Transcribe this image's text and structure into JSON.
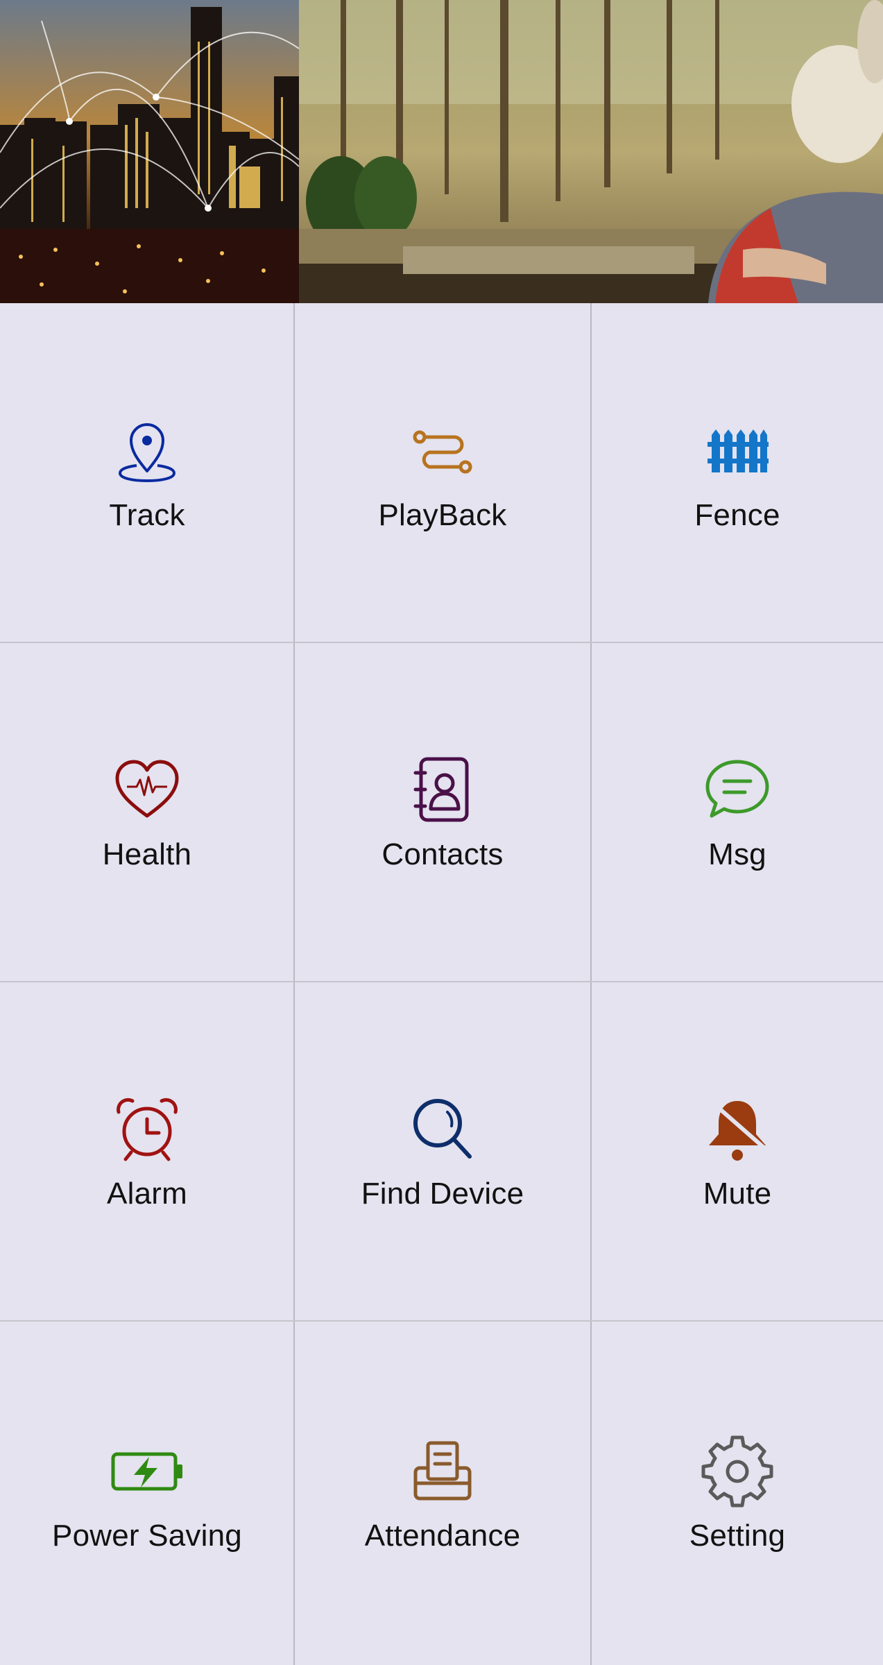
{
  "menu": {
    "items": [
      {
        "id": "track",
        "label": "Track",
        "icon": "map-pin-icon",
        "color": "#0a2aa0"
      },
      {
        "id": "playback",
        "label": "PlayBack",
        "icon": "route-icon",
        "color": "#b8731f"
      },
      {
        "id": "fence",
        "label": "Fence",
        "icon": "fence-icon",
        "color": "#1476c9"
      },
      {
        "id": "health",
        "label": "Health",
        "icon": "heart-pulse-icon",
        "color": "#8b0d0d"
      },
      {
        "id": "contacts",
        "label": "Contacts",
        "icon": "contact-book-icon",
        "color": "#4a1048"
      },
      {
        "id": "msg",
        "label": "Msg",
        "icon": "chat-bubble-icon",
        "color": "#3d9a2a"
      },
      {
        "id": "alarm",
        "label": "Alarm",
        "icon": "alarm-clock-icon",
        "color": "#a01212"
      },
      {
        "id": "find_device",
        "label": "Find Device",
        "icon": "magnifier-icon",
        "color": "#0e2e6b"
      },
      {
        "id": "mute",
        "label": "Mute",
        "icon": "bell-mute-icon",
        "color": "#9a3b10"
      },
      {
        "id": "power_saving",
        "label": "Power Saving",
        "icon": "battery-charging-icon",
        "color": "#2f8a12"
      },
      {
        "id": "attendance",
        "label": "Attendance",
        "icon": "printer-icon",
        "color": "#8a5a2c"
      },
      {
        "id": "setting",
        "label": "Setting",
        "icon": "gear-icon",
        "color": "#5a5a5a"
      }
    ]
  }
}
